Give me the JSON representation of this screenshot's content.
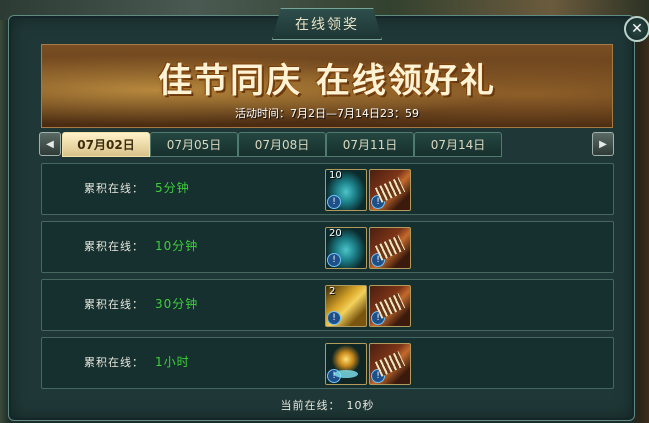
{
  "window": {
    "title": "在线领奖",
    "close_glyph": "✕"
  },
  "banner": {
    "title": "佳节同庆 在线领好礼",
    "subtitle": "活动时间：7月2日—7月14日23：59"
  },
  "tabs": [
    {
      "label": "07月02日",
      "active": true
    },
    {
      "label": "07月05日",
      "active": false
    },
    {
      "label": "07月08日",
      "active": false
    },
    {
      "label": "07月11日",
      "active": false
    },
    {
      "label": "07月14日",
      "active": false
    }
  ],
  "nav": {
    "prev_glyph": "◀",
    "next_glyph": "▶"
  },
  "rows": [
    {
      "label": "累积在线：",
      "value": "5分钟",
      "items": [
        {
          "icon": "teal-cloud-icon",
          "count": "10"
        },
        {
          "icon": "scroll-icon",
          "count": ""
        }
      ]
    },
    {
      "label": "累积在线：",
      "value": "10分钟",
      "items": [
        {
          "icon": "teal-cloud-icon",
          "count": "20"
        },
        {
          "icon": "scroll-icon",
          "count": ""
        }
      ]
    },
    {
      "label": "累积在线：",
      "value": "30分钟",
      "items": [
        {
          "icon": "golden-talisman-icon",
          "count": "2"
        },
        {
          "icon": "scroll-icon",
          "count": ""
        }
      ]
    },
    {
      "label": "累积在线：",
      "value": "1小时",
      "items": [
        {
          "icon": "glowing-orb-icon",
          "count": ""
        },
        {
          "icon": "scroll-icon",
          "count": ""
        }
      ]
    }
  ],
  "item_info_glyph": "!",
  "footer": {
    "label": "当前在线：",
    "value": "10秒"
  }
}
